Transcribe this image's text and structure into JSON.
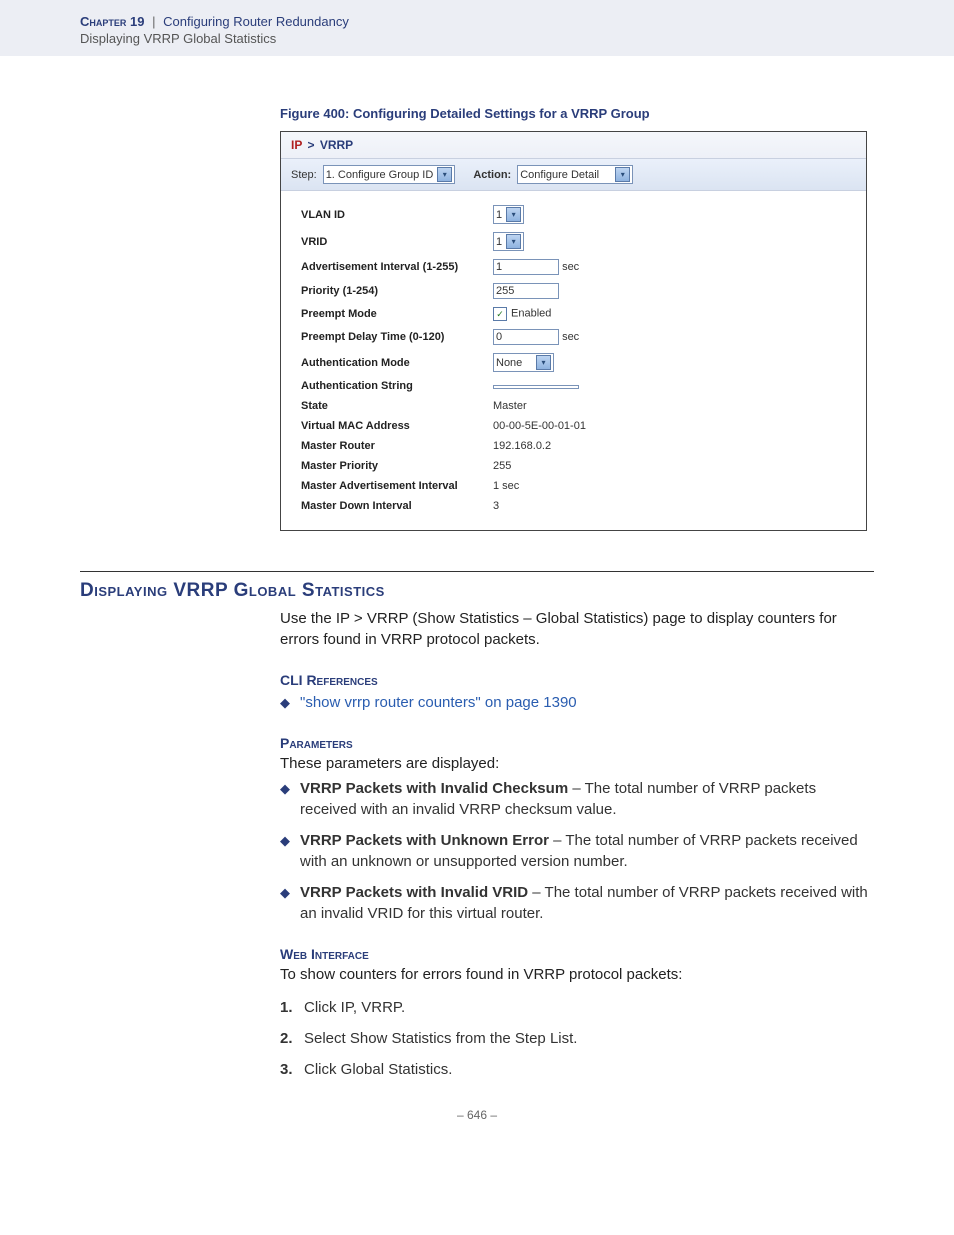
{
  "header": {
    "chapter_label": "Chapter 19",
    "separator": "|",
    "chapter_title": "Configuring Router Redundancy",
    "subtitle": "Displaying VRRP Global Statistics"
  },
  "figure": {
    "caption": "Figure 400:  Configuring Detailed Settings for a VRRP Group",
    "breadcrumb_root": "IP",
    "breadcrumb_sep": ">",
    "breadcrumb_current": "VRRP",
    "step_label": "Step:",
    "step_value": "1. Configure Group ID",
    "action_label": "Action:",
    "action_value": "Configure Detail",
    "rows": [
      {
        "label": "VLAN ID",
        "kind": "dropdown_small",
        "value": "1"
      },
      {
        "label": "VRID",
        "kind": "dropdown_small",
        "value": "1"
      },
      {
        "label": "Advertisement Interval (1-255)",
        "kind": "input_unit",
        "value": "1",
        "unit": "sec"
      },
      {
        "label": "Priority (1-254)",
        "kind": "input",
        "value": "255"
      },
      {
        "label": "Preempt Mode",
        "kind": "checkbox",
        "checked": true,
        "value": "Enabled"
      },
      {
        "label": "Preempt Delay Time (0-120)",
        "kind": "input_unit",
        "value": "0",
        "unit": "sec"
      },
      {
        "label": "Authentication Mode",
        "kind": "dropdown_med",
        "value": "None"
      },
      {
        "label": "Authentication String",
        "kind": "input_empty",
        "value": ""
      },
      {
        "label": "State",
        "kind": "text",
        "value": "Master"
      },
      {
        "label": "Virtual MAC Address",
        "kind": "text",
        "value": "00-00-5E-00-01-01"
      },
      {
        "label": "Master Router",
        "kind": "text",
        "value": "192.168.0.2"
      },
      {
        "label": "Master Priority",
        "kind": "text",
        "value": "255"
      },
      {
        "label": "Master Advertisement Interval",
        "kind": "text",
        "value": "1 sec"
      },
      {
        "label": "Master Down Interval",
        "kind": "text",
        "value": "3"
      }
    ]
  },
  "section": {
    "title": "Displaying VRRP Global Statistics",
    "intro": "Use the IP > VRRP (Show Statistics – Global Statistics) page to display counters for errors found in VRRP protocol packets."
  },
  "cli": {
    "heading": "CLI References",
    "link_text": "\"show vrrp router counters\" on page 1390"
  },
  "params": {
    "heading": "Parameters",
    "intro": "These parameters are displayed:",
    "items": [
      {
        "bold": "VRRP Packets with Invalid Checksum",
        "rest": " – The total number of VRRP packets received with an invalid VRRP checksum value."
      },
      {
        "bold": "VRRP Packets with Unknown Error",
        "rest": " – The total number of VRRP packets received with an unknown or unsupported version number."
      },
      {
        "bold": "VRRP Packets with Invalid VRID",
        "rest": " – The total number of VRRP packets received with an invalid VRID for this virtual router."
      }
    ]
  },
  "web": {
    "heading": "Web Interface",
    "intro": "To show counters for errors found in VRRP protocol packets:",
    "steps": [
      "Click IP, VRRP.",
      "Select Show Statistics from the Step List.",
      "Click Global Statistics."
    ]
  },
  "footer": {
    "page": "–  646  –"
  }
}
